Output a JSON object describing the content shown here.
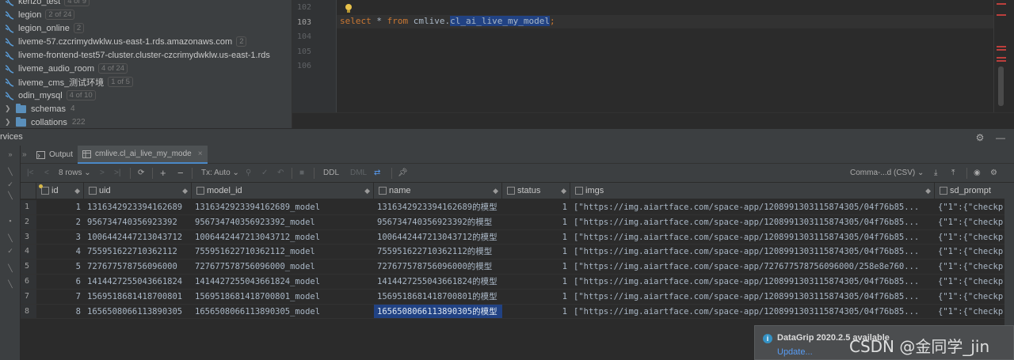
{
  "tree": {
    "items": [
      {
        "label": "kenzo_test",
        "badge": "4 of 9"
      },
      {
        "label": "legion",
        "badge": "2 of 24"
      },
      {
        "label": "legion_online",
        "badge": "2"
      },
      {
        "label": "liveme-57.czcrimydwklw.us-east-1.rds.amazonaws.com",
        "badge": "2"
      },
      {
        "label": "liveme-frontend-test57-cluster.cluster-czcrimydwklw.us-east-1.rds",
        "badge": ""
      },
      {
        "label": "liveme_audio_room",
        "badge": "4 of 24"
      },
      {
        "label": "liveme_cms_测试环境",
        "badge": "1 of 5"
      },
      {
        "label": "odin_mysql",
        "badge": "4 of 10"
      }
    ],
    "folders": [
      {
        "label": "schemas",
        "count": "4"
      },
      {
        "label": "collations",
        "count": "222"
      }
    ]
  },
  "editor": {
    "line_numbers": [
      "102",
      "103",
      "104",
      "105",
      "106"
    ],
    "current_line": "103",
    "code": {
      "kw_select": "select",
      "star": " * ",
      "kw_from": "from",
      "schema": " cmlive.",
      "table": "cl_ai_live_my_model",
      "semicolon": ";"
    }
  },
  "services": {
    "title": "rvices"
  },
  "tabs": [
    {
      "label": "Output",
      "active": false
    },
    {
      "label": "cmlive.cl_ai_live_my_mode",
      "active": true
    }
  ],
  "toolbar": {
    "rows": "8 rows",
    "tx": "Tx: Auto",
    "ddl": "DDL",
    "dml": "DML",
    "export_format": "Comma-...d (CSV)"
  },
  "grid": {
    "columns": [
      "id",
      "uid",
      "model_id",
      "name",
      "status",
      "imgs",
      "sd_prompt"
    ],
    "rows": [
      {
        "n": "1",
        "id": "1",
        "uid": "1316342923394162689",
        "model_id": "1316342923394162689_model",
        "name": "1316342923394162689的模型",
        "status": "1",
        "imgs": "[\"https://img.aiartface.com/space-app/1208991303115874305/04f76b85...",
        "sd_prompt": "{\"1\":{\"checkp"
      },
      {
        "n": "2",
        "id": "2",
        "uid": "956734740356923392",
        "model_id": "956734740356923392_model",
        "name": "956734740356923392的模型",
        "status": "1",
        "imgs": "[\"https://img.aiartface.com/space-app/1208991303115874305/04f76b85...",
        "sd_prompt": "{\"1\":{\"checkp"
      },
      {
        "n": "3",
        "id": "3",
        "uid": "1006442447213043712",
        "model_id": "1006442447213043712_model",
        "name": "1006442447213043712的模型",
        "status": "1",
        "imgs": "[\"https://img.aiartface.com/space-app/1208991303115874305/04f76b85...",
        "sd_prompt": "{\"1\":{\"checkp"
      },
      {
        "n": "4",
        "id": "4",
        "uid": "755951622710362112",
        "model_id": "755951622710362112_model",
        "name": "755951622710362112的模型",
        "status": "1",
        "imgs": "[\"https://img.aiartface.com/space-app/1208991303115874305/04f76b85...",
        "sd_prompt": "{\"1\":{\"checkp"
      },
      {
        "n": "5",
        "id": "5",
        "uid": "727677578756096000",
        "model_id": "727677578756096000_model",
        "name": "727677578756096000的模型",
        "status": "1",
        "imgs": "[\"https://img.aiartface.com/space-app/727677578756096000/258e8e760...",
        "sd_prompt": "{\"1\":{\"checkp"
      },
      {
        "n": "6",
        "id": "6",
        "uid": "1414427255043661824",
        "model_id": "1414427255043661824_model",
        "name": "1414427255043661824的模型",
        "status": "1",
        "imgs": "[\"https://img.aiartface.com/space-app/1208991303115874305/04f76b85...",
        "sd_prompt": "{\"1\":{\"checkp"
      },
      {
        "n": "7",
        "id": "7",
        "uid": "1569518681418700801",
        "model_id": "1569518681418700801_model",
        "name": "1569518681418700801的模型",
        "status": "1",
        "imgs": "[\"https://img.aiartface.com/space-app/1208991303115874305/04f76b85...",
        "sd_prompt": "{\"1\":{\"checkp"
      },
      {
        "n": "8",
        "id": "8",
        "uid": "1656508066113890305",
        "model_id": "1656508066113890305_model",
        "name": "1656508066113890305的模型",
        "status": "1",
        "imgs": "[\"https://img.aiartface.com/space-app/1208991303115874305/04f76b85...",
        "sd_prompt": "{\"1\":{\"checkp"
      }
    ],
    "selected_row": 8,
    "selected_column": "name"
  },
  "notification": {
    "title": "DataGrip 2020.2.5 available",
    "link": "Update..."
  },
  "watermark": "CSDN @金同学_jin",
  "colors": {
    "keyword": "#cc7832",
    "selection": "#214283",
    "link": "#589df6",
    "error_mark": "#bc3f3c"
  },
  "icons": [
    "datasource-icon",
    "folder-icon",
    "bulb-icon",
    "settings-icon",
    "minimize-icon",
    "refresh-icon",
    "add-icon",
    "remove-icon",
    "export-icon",
    "eye-icon",
    "info-icon"
  ]
}
